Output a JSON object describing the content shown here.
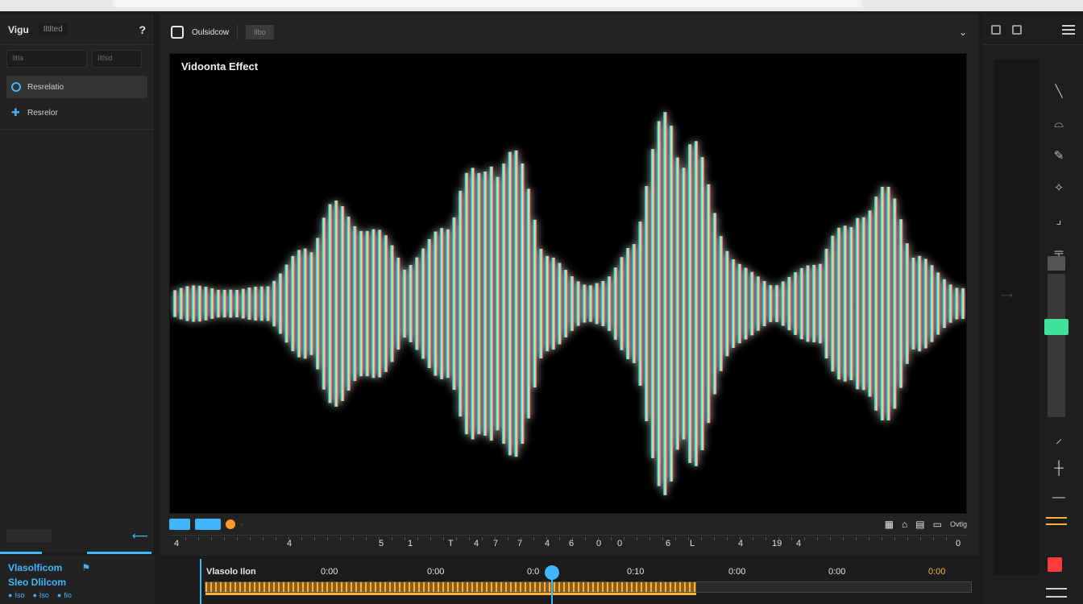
{
  "left_panel": {
    "title": "Vigu",
    "subtitle": "Iltlted",
    "help_icon": "question-icon",
    "filters": [
      "Iltla",
      "Iltlsd"
    ],
    "items": [
      {
        "label": "Resrelatio",
        "icon": "ring-icon",
        "active": true
      },
      {
        "label": "Resrelor",
        "icon": "plus-icon",
        "active": false
      }
    ]
  },
  "main_panel": {
    "app_name": "Oulsidcow",
    "chip": "Ilbo",
    "viewer_title": "Vidoonta Effect",
    "controls": {
      "right_label": "Ovtlg"
    }
  },
  "ruler": {
    "marks": [
      "4",
      "4",
      "5",
      "1",
      "T",
      "4",
      "7",
      "7",
      "4",
      "6",
      "0",
      "0",
      "6",
      "L",
      "4",
      "19",
      "4",
      "0"
    ]
  },
  "bottom_left": {
    "line1": "Vlasolficom",
    "line2": "Sleo Dlilcom",
    "chips": [
      "Iso",
      "Iso",
      "fio"
    ]
  },
  "timeline": {
    "track_label": "Vlasolo Ilon",
    "labels": [
      "0:00",
      "0:00",
      "0:0",
      "0:10",
      "0:00",
      "0:00",
      "0:00"
    ],
    "fill_fraction": 0.64,
    "playhead_fraction": 0.44
  },
  "colors": {
    "accent": "#3fb6ff",
    "orange": "#ffb23a",
    "green": "#3ee29a",
    "red": "#ff3b3b"
  }
}
